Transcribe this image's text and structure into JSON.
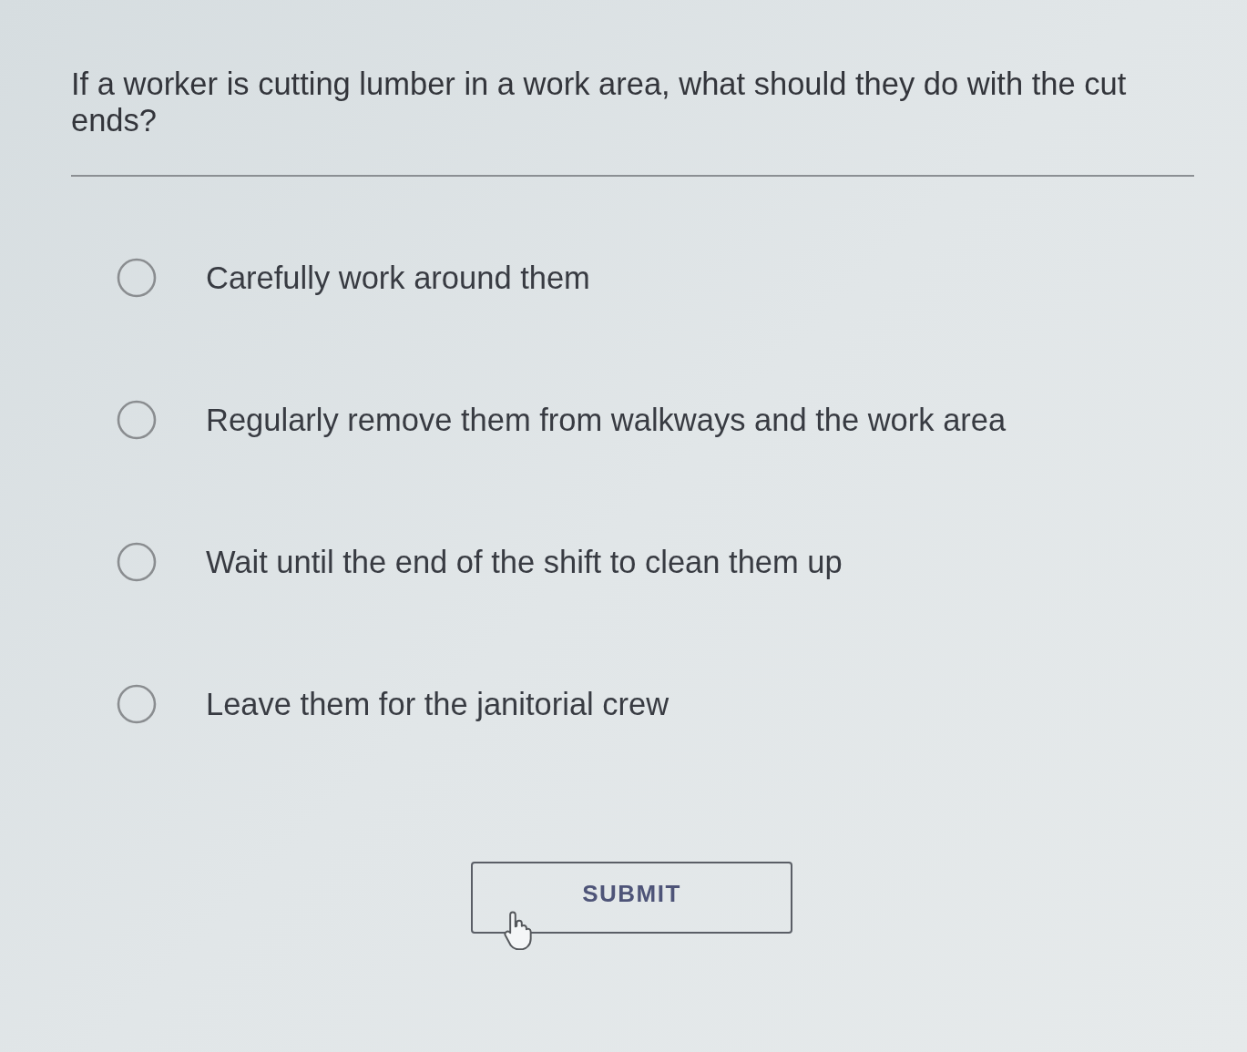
{
  "question": {
    "text": "If a worker is cutting lumber in a work area, what should they do with the cut ends?"
  },
  "options": [
    {
      "label": "Carefully work around them",
      "selected": false
    },
    {
      "label": "Regularly remove them from walkways and the work area",
      "selected": false
    },
    {
      "label": "Wait until the end of the shift to clean them up",
      "selected": false
    },
    {
      "label": "Leave them for the janitorial crew",
      "selected": false
    }
  ],
  "submit_button": {
    "label": "SUBMIT"
  }
}
